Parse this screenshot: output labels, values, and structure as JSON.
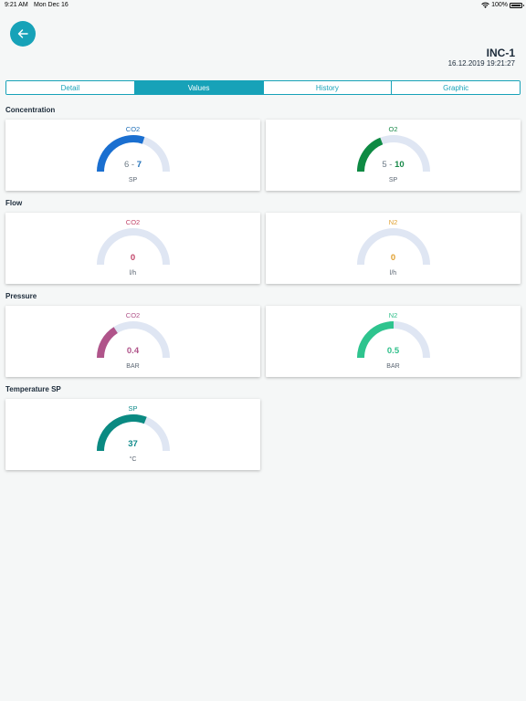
{
  "status_bar": {
    "time": "9:21 AM",
    "date": "Mon Dec 16",
    "battery": "100%"
  },
  "header": {
    "title": "INC-1",
    "timestamp": "16.12.2019 19:21:27"
  },
  "tabs": [
    {
      "label": "Detail",
      "active": false
    },
    {
      "label": "Values",
      "active": true
    },
    {
      "label": "History",
      "active": false
    },
    {
      "label": "Graphic",
      "active": false
    }
  ],
  "sections": [
    {
      "title": "Concentration",
      "cards": [
        {
          "label": "CO2",
          "label_color": "#1f6fb8",
          "value_lo": "6",
          "sep": " - ",
          "value_hi": "7",
          "value_color": "#1f6fb8",
          "unit": "SP",
          "level": 0.6,
          "arc_color": "#1a6fd0"
        },
        {
          "label": "O2",
          "label_color": "#1a8a4a",
          "value_lo": "5",
          "sep": " - ",
          "value_hi": "10",
          "value_color": "#1a8a4a",
          "unit": "SP",
          "level": 0.38,
          "arc_color": "#0e8a43"
        }
      ]
    },
    {
      "title": "Flow",
      "cards": [
        {
          "label": "CO2",
          "label_color": "#c2456a",
          "value_lo": "",
          "sep": "",
          "value_hi": "0",
          "value_color": "#c2456a",
          "unit": "l/h",
          "level": 0,
          "arc_color": "#c2456a"
        },
        {
          "label": "N2",
          "label_color": "#e0a030",
          "value_lo": "",
          "sep": "",
          "value_hi": "0",
          "value_color": "#e0a030",
          "unit": "l/h",
          "level": 0,
          "arc_color": "#e0a030"
        }
      ]
    },
    {
      "title": "Pressure",
      "cards": [
        {
          "label": "CO2",
          "label_color": "#b0548a",
          "value_lo": "",
          "sep": "",
          "value_hi": "0.4",
          "value_color": "#b0548a",
          "unit": "BAR",
          "level": 0.32,
          "arc_color": "#b0548a"
        },
        {
          "label": "N2",
          "label_color": "#2fbf8a",
          "value_lo": "",
          "sep": "",
          "value_hi": "0.5",
          "value_color": "#2fbf8a",
          "unit": "BAR",
          "level": 0.5,
          "arc_color": "#2ec48e"
        }
      ]
    },
    {
      "title": "Temperature SP",
      "cards": [
        {
          "label": "SP",
          "label_color": "#0e8a8a",
          "value_lo": "",
          "sep": "",
          "value_hi": "37",
          "value_color": "#0e8a8a",
          "unit": "°C",
          "level": 0.62,
          "arc_color": "#0a8a82"
        }
      ]
    }
  ],
  "colors": {
    "accent": "#17a2b8",
    "gauge_track": "#dfe6f3"
  }
}
